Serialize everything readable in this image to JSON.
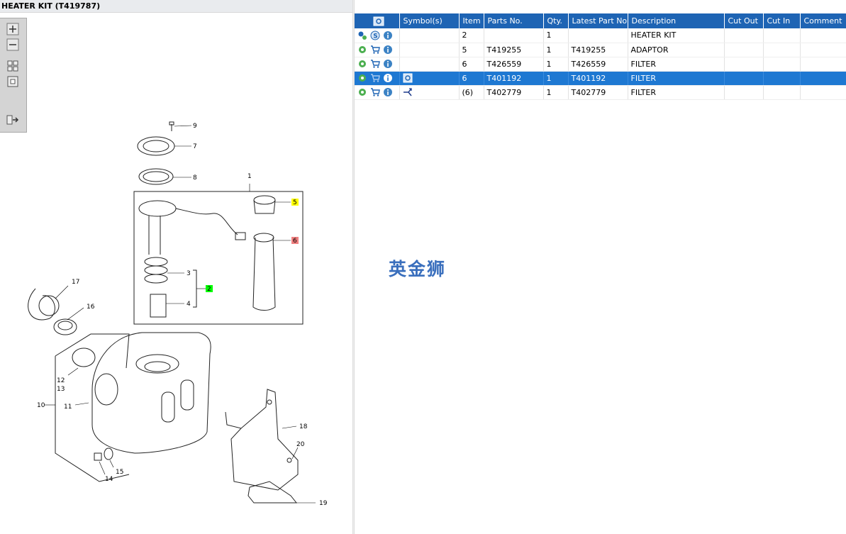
{
  "title": "HEATER KIT (T419787)",
  "toolbar": {
    "items": [
      "zoom-in-icon",
      "zoom-out-icon",
      "fit-all-icon",
      "fit-window-icon",
      "show-list-icon"
    ]
  },
  "diagram": {
    "callouts": [
      "9",
      "7",
      "8",
      "1",
      "5",
      "6",
      "3",
      "2",
      "4",
      "17",
      "16",
      "12",
      "13",
      "10",
      "11",
      "18",
      "20",
      "15",
      "14",
      "19"
    ],
    "highlight_colors": {
      "yellow": "#ffff00",
      "red": "#f08080",
      "green": "#00ff00"
    }
  },
  "grid": {
    "columns": [
      "",
      "Symbol(s)",
      "Item",
      "Parts No.",
      "Qty.",
      "Latest Part No.",
      "Description",
      "Cut Out",
      "Cut In",
      "Comment"
    ],
    "rows": [
      {
        "icons": [
          "gears-icon",
          "s-badge-icon",
          "info-icon"
        ],
        "symbol": "",
        "item": "2",
        "part": "",
        "qty": "1",
        "latest": "",
        "desc": "HEATER KIT",
        "cutout": "",
        "cutin": "",
        "comment": ""
      },
      {
        "icons": [
          "gear-icon",
          "cart-icon",
          "info-icon"
        ],
        "symbol": "",
        "item": "5",
        "part": "T419255",
        "qty": "1",
        "latest": "T419255",
        "desc": "ADAPTOR",
        "cutout": "",
        "cutin": "",
        "comment": ""
      },
      {
        "icons": [
          "gear-icon",
          "cart-icon",
          "info-icon"
        ],
        "symbol": "",
        "item": "6",
        "part": "T426559",
        "qty": "1",
        "latest": "T426559",
        "desc": "FILTER",
        "cutout": "",
        "cutin": "",
        "comment": ""
      },
      {
        "icons": [
          "gear-icon",
          "cart-icon",
          "info-icon"
        ],
        "symbol": "view-icon",
        "item": "6",
        "part": "T401192",
        "qty": "1",
        "latest": "T401192",
        "desc": "FILTER",
        "cutout": "",
        "cutin": "",
        "comment": "",
        "selected": true
      },
      {
        "icons": [
          "gear-icon",
          "cart-icon",
          "info-icon"
        ],
        "symbol": "branch-icon",
        "item": "(6)",
        "part": "T402779",
        "qty": "1",
        "latest": "T402779",
        "desc": "FILTER",
        "cutout": "",
        "cutin": "",
        "comment": ""
      }
    ]
  },
  "watermark": "英金狮",
  "colors": {
    "header": "#1e64b4",
    "selected": "#1e78d2",
    "gear": "#4caf50",
    "cart": "#1e64b4",
    "info": "#3b82c4"
  }
}
